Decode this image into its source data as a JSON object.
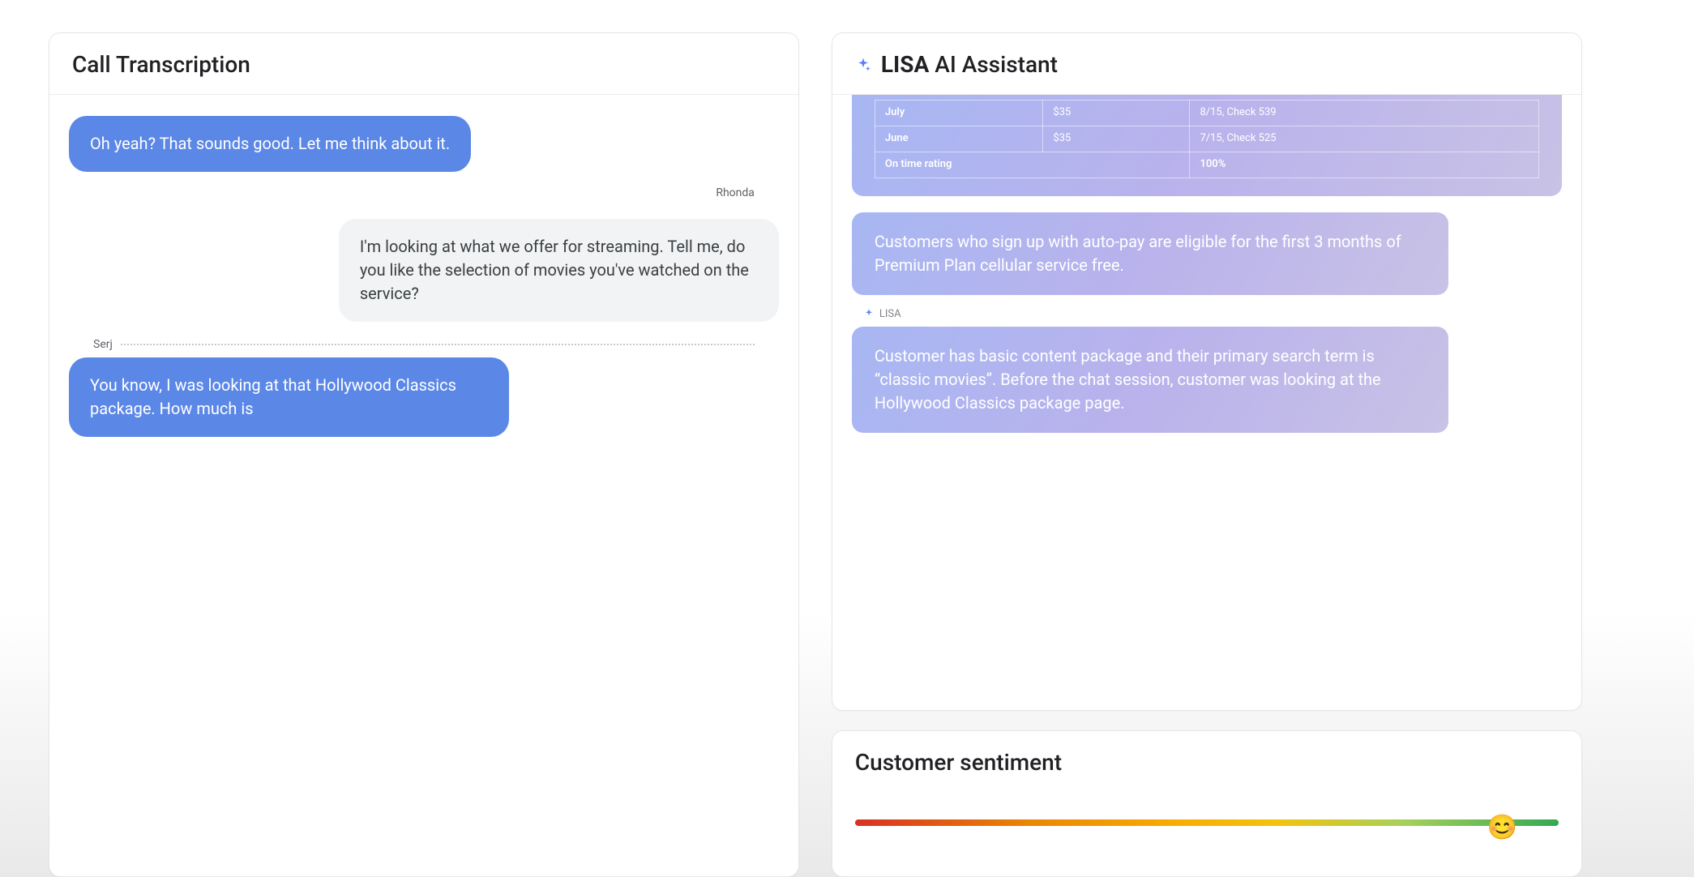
{
  "transcription": {
    "title": "Call Transcription",
    "messages": [
      {
        "side": "me",
        "speaker": "",
        "text": "Oh yeah? That sounds good. Let me think about it."
      },
      {
        "side": "them",
        "speaker": "Rhonda",
        "text": "I'm looking at what we offer for streaming. Tell me, do you like the selection of movies you've watched on the service?"
      },
      {
        "side": "me",
        "speaker": "Serj",
        "divider": true,
        "text": "You know, I was looking at that Hollywood Classics package. How much is"
      }
    ]
  },
  "assistant": {
    "title_bold": "LISA",
    "title_rest": "AI Assistant",
    "history_table": {
      "rows": [
        {
          "label": "July",
          "amount": "$35",
          "note": "8/15, Check 539"
        },
        {
          "label": "June",
          "amount": "$35",
          "note": "7/15, Check 525"
        }
      ],
      "footer_label": "On time rating",
      "footer_value": "100%"
    },
    "cards": [
      {
        "text": "Customers who sign up with auto-pay are eligible for the first 3 months of Premium Plan cellular service free."
      },
      {
        "label": "LISA",
        "text": "Customer has basic content package and their primary search term is “classic movies”. Before the chat session, customer was looking at the Hollywood Classics package page."
      }
    ]
  },
  "sentiment": {
    "title": "Customer sentiment",
    "value_percent": 92,
    "emoji": "😊"
  }
}
